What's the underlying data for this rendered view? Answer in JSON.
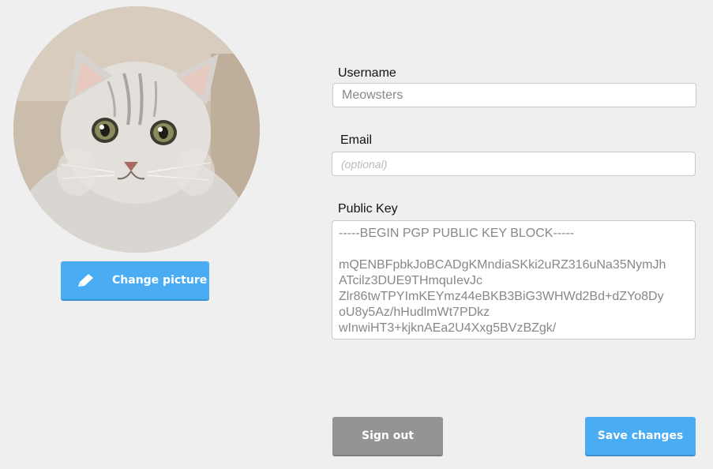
{
  "profile": {
    "change_picture_label": "Change picture"
  },
  "form": {
    "username_label": "Username",
    "username_value": "Meowsters",
    "email_label": "Email",
    "email_placeholder": "(optional)",
    "public_key_label": "Public Key",
    "public_key_value": "-----BEGIN PGP PUBLIC KEY BLOCK-----\n\nmQENBFpbkJoBCADgKMndiaSKki2uRZ316uNa35NymJh\nATcilz3DUE9THmquIevJc\nZlr86twTPYImKEYmz44eBKB3BiG3WHWd2Bd+dZYo8Dy\noU8y5Az/hHudlmWt7PDkz\nwInwiHT3+kjknAEa2U4Xxg5BVzBZgk/"
  },
  "actions": {
    "sign_out_label": "Sign out",
    "save_label": "Save changes"
  },
  "colors": {
    "accent": "#4aacf3",
    "secondary": "#949494",
    "background": "#efefef"
  },
  "icons": {
    "change_picture": "pencil-icon"
  }
}
